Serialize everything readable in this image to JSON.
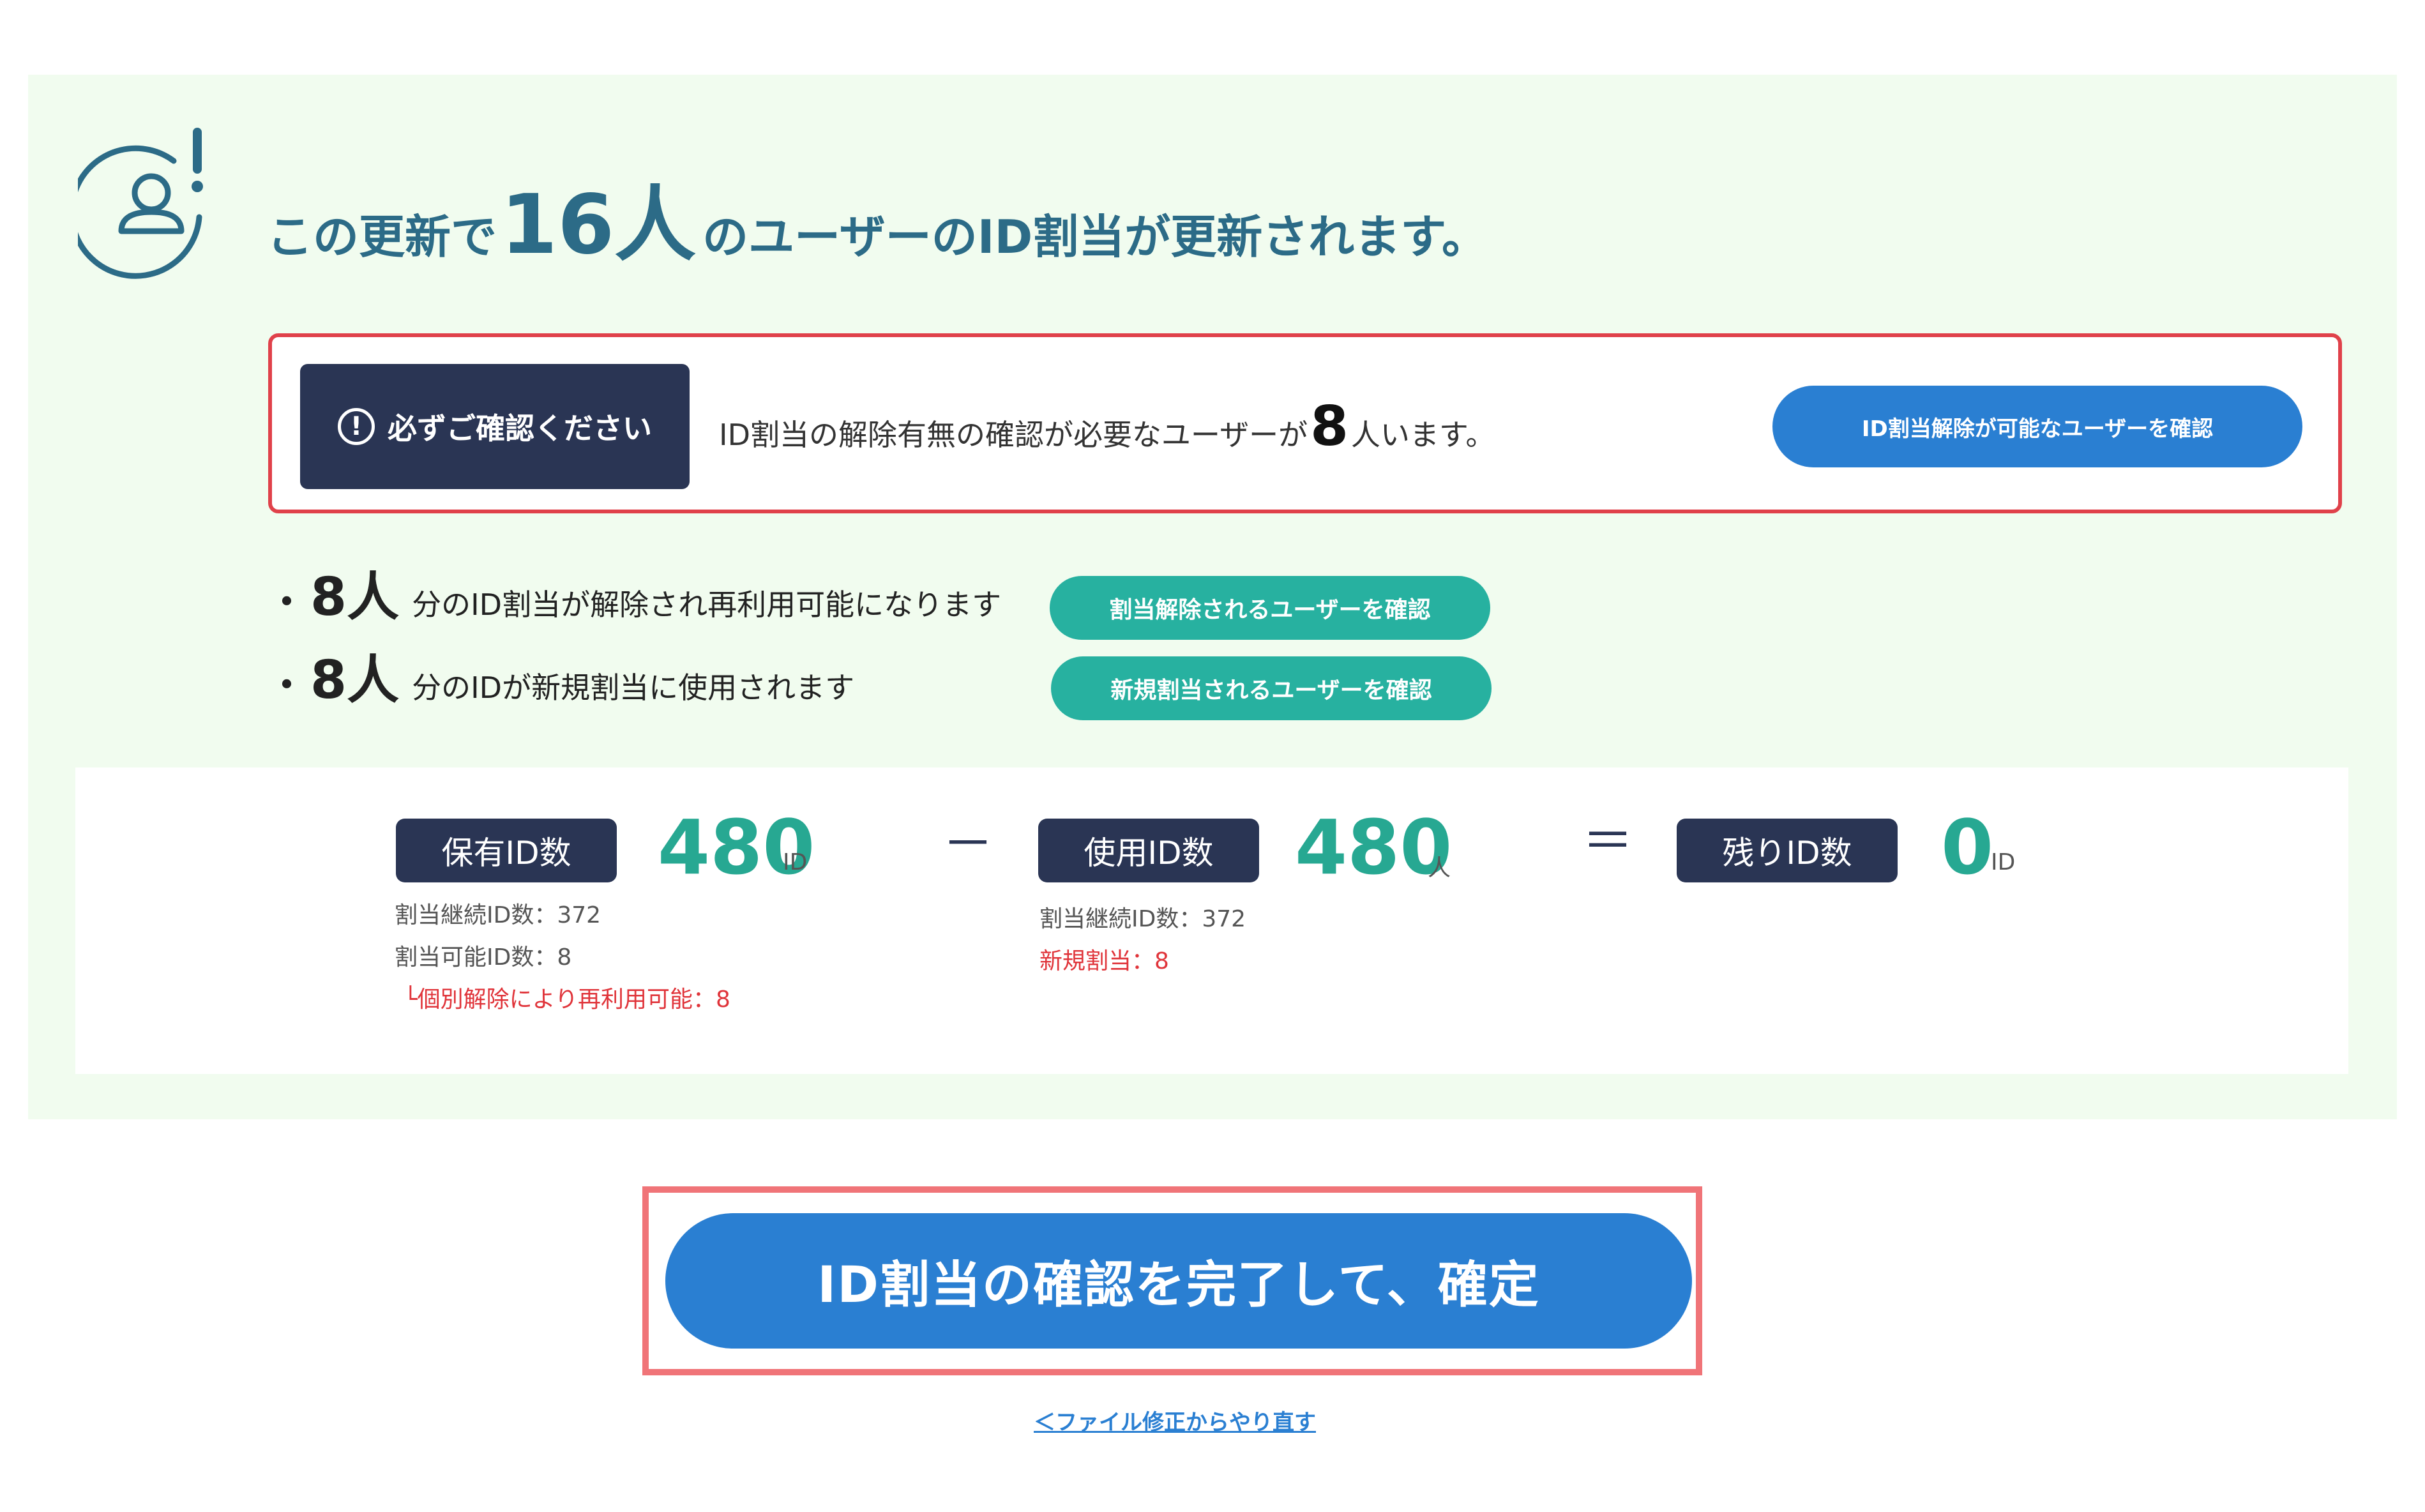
{
  "header": {
    "pre": "この更新で",
    "count": "16人",
    "post": "のユーザーのID割当が更新されます。"
  },
  "alert": {
    "badge_label": "必ずご確認ください",
    "badge_icon": "!",
    "text_pre": "ID割当の解除有無の確認が必要なユーザーが",
    "count": "8",
    "text_post": "人います。",
    "button_label": "ID割当解除が可能なユーザーを確認"
  },
  "bullets": [
    {
      "dot": "・",
      "count": "8人",
      "text": "分のID割当が解除され再利用可能になります",
      "button_label": "割当解除されるユーザーを確認"
    },
    {
      "dot": "・",
      "count": "8人",
      "text": "分のIDが新規割当に使用されます",
      "button_label": "新規割当されるユーザーを確認"
    }
  ],
  "stats": {
    "owned": {
      "label": "保有ID数",
      "value": "480",
      "unit": "ID",
      "sub1": "割当継続ID数：372",
      "sub2": "割当可能ID数：8",
      "sub3": "└個別解除により再利用可能：8"
    },
    "minus": "－",
    "used": {
      "label": "使用ID数",
      "value": "480",
      "unit": "人",
      "sub1": "割当継続ID数：372",
      "sub2": "新規割当：8"
    },
    "equals": "＝",
    "remaining": {
      "label": "残りID数",
      "value": "0",
      "unit": "ID"
    }
  },
  "confirm_label": "ID割当の確認を完了して、確定",
  "redo_link": "＜ファイル修正からやり直す",
  "colors": {
    "navy": "#2a3554",
    "teal": "#27b1a0",
    "blue": "#2a7fd2",
    "alert_red": "#e0414a",
    "panel_bg": "#f1fcef"
  }
}
